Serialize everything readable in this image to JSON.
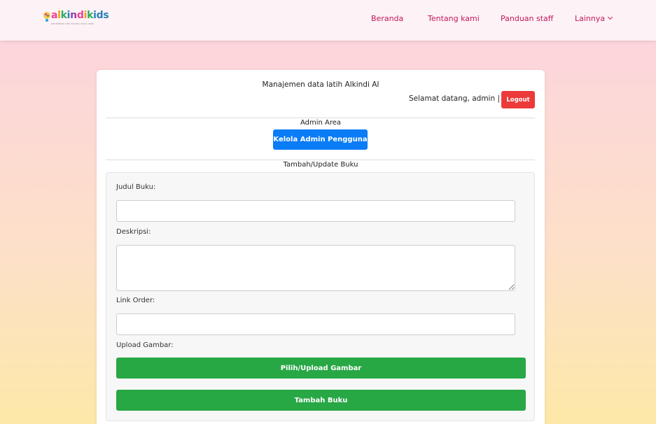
{
  "brand": {
    "logo_letters": [
      "a",
      "l",
      "k",
      "i",
      "n",
      "d",
      "i",
      "k",
      "ids"
    ],
    "tagline": "pendidikan dan inovasi untuk anak"
  },
  "nav": {
    "items": [
      {
        "label": "Beranda"
      },
      {
        "label": "Tentang kami"
      },
      {
        "label": "Panduan staff"
      },
      {
        "label": "Lainnya"
      }
    ]
  },
  "header": {
    "title": "Manajemen data latih Alkindi AI",
    "welcome": "Selamat datang, admin |",
    "logout_label": "Logout"
  },
  "admin": {
    "section_label": "Admin Area",
    "manage_button": "Kelola Admin Pengguna"
  },
  "form": {
    "section_label": "Tambah/Update Buku",
    "title_label": "Judul Buku:",
    "title_value": "",
    "description_label": "Deskripsi:",
    "description_value": "",
    "link_label": "Link Order:",
    "link_value": "",
    "upload_label": "Upload Gambar:",
    "upload_button": "Pilih/Upload Gambar",
    "submit_button": "Tambah Buku"
  },
  "colors": {
    "nav_link": "#c2185b",
    "logout": "#ec3a3a",
    "primary": "#0a7cf5",
    "success": "#28a745"
  }
}
